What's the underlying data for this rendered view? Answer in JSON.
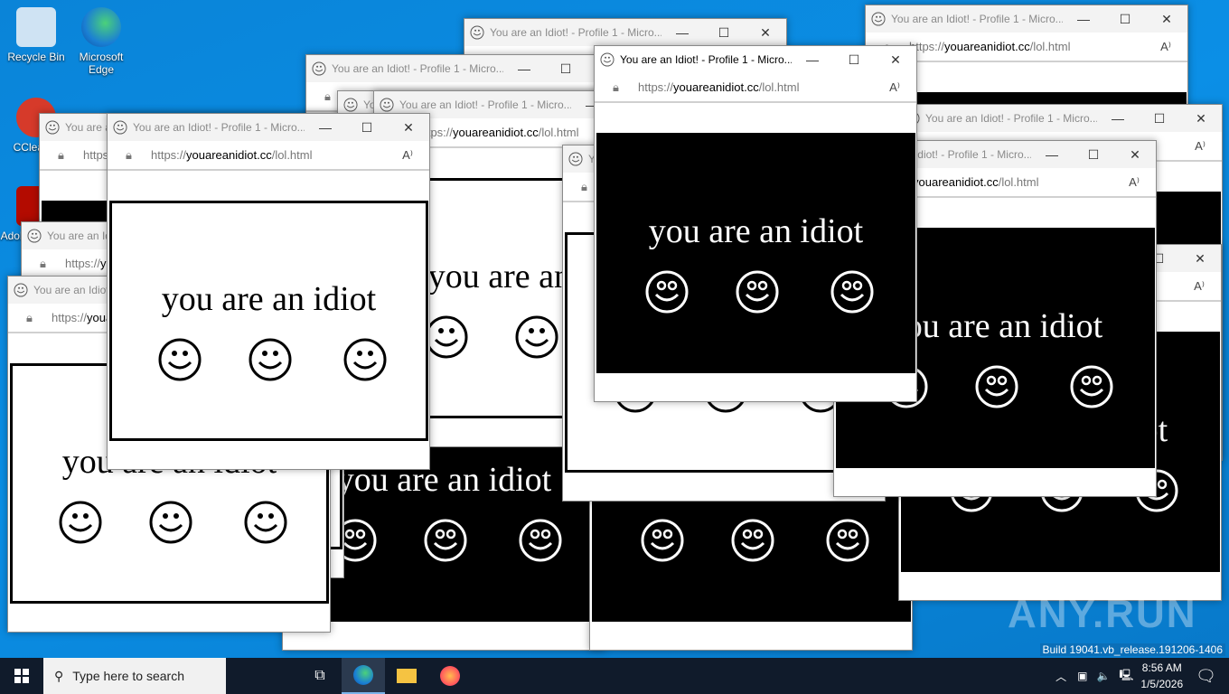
{
  "desktop": {
    "icons": [
      {
        "label": "Recycle Bin"
      },
      {
        "label": "Microsoft Edge"
      },
      {
        "label": "CCleaner"
      },
      {
        "label": "Adobe Acrobat"
      }
    ]
  },
  "window": {
    "title": "You are an Idiot! - Profile 1 - Micro...",
    "url_scheme": "https://",
    "url_domain": "youareanidiot.cc",
    "url_path": "/lol.html",
    "page_text": "you are an idiot",
    "minimize": "—",
    "maximize": "☐",
    "close": "✕",
    "read_aloud": "A⁾"
  },
  "taskbar": {
    "search_placeholder": "Type here to search",
    "time": "8:56 AM",
    "date": "1/5/2026"
  },
  "watermark": {
    "build": "Build 19041.vb_release.191206-1406",
    "brand": "ANY.RUN"
  },
  "colors": {
    "desktop": "#0a84d8",
    "taskbar": "#101b2b"
  }
}
